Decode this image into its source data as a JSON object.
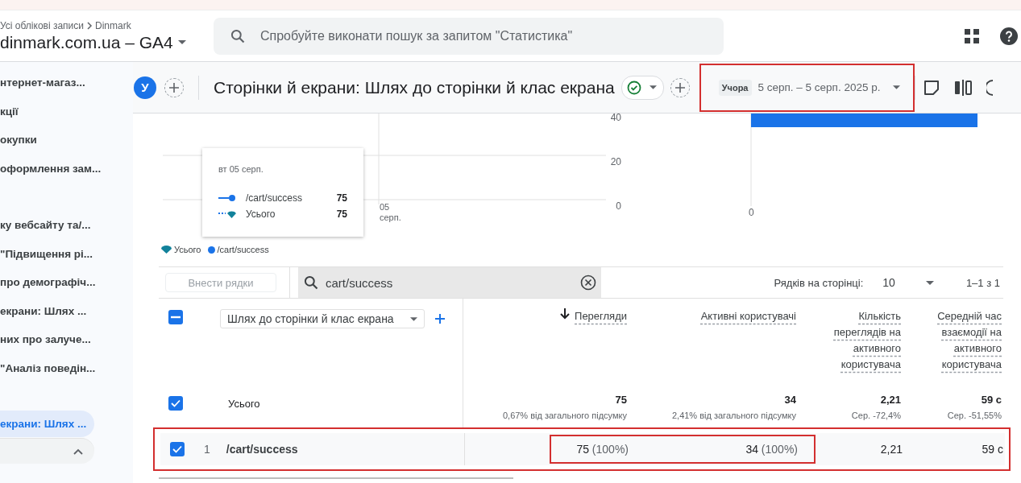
{
  "header": {
    "breadcrumb": [
      "Усі облікові записи",
      "Dinmark"
    ],
    "property": "dinmark.com.ua – GA4",
    "search": {
      "placeholder": "Спробуйте виконати пошук за запитом \"Статистика\""
    }
  },
  "sidebar": {
    "groups": [
      {
        "items": [
          {
            "label": "нтернет-магаз...",
            "selected": false
          },
          {
            "label": "кції",
            "selected": false
          },
          {
            "label": "окупки",
            "selected": false
          },
          {
            "label": "оформлення зам...",
            "selected": false
          }
        ]
      },
      {
        "items": [
          {
            "label": "ку вебсайту та/...",
            "selected": false
          },
          {
            "label": "\"Підвищення рі...",
            "selected": false
          },
          {
            "label": "про демографіч...",
            "selected": false
          },
          {
            "label": "екрани: Шлях ...",
            "selected": false
          },
          {
            "label": "них про залуче...",
            "selected": false
          },
          {
            "label": "\"Аналіз поведін...",
            "selected": false
          }
        ]
      },
      {
        "items": [
          {
            "label": "екрани: Шлях ...",
            "selected": true
          }
        ]
      }
    ],
    "collapse": {
      "expanded": true
    }
  },
  "toolbar": {
    "avatar": "У",
    "title": "Сторінки й екрани: Шлях до сторінки й клас екрана",
    "date_range": {
      "chip": "Учора",
      "range": "5 серп. – 5 серп. 2025 р.",
      "highlighted": true
    }
  },
  "line_chart": {
    "y_ticks": [
      "40",
      "20",
      "0"
    ],
    "x_label": "05 серп.",
    "tooltip": {
      "date": "вт 05 серп.",
      "rows": [
        {
          "kind": "line",
          "name": "/cart/success",
          "value": "75"
        },
        {
          "kind": "total",
          "name": "Усього",
          "value": "75"
        }
      ]
    },
    "legend": [
      {
        "kind": "total",
        "name": "Усього"
      },
      {
        "kind": "line",
        "name": "/cart/success"
      }
    ]
  },
  "bar_chart": {
    "x_tick": "0"
  },
  "table": {
    "add_rows": "Внести рядки",
    "search": {
      "value": "cart/success"
    },
    "rows_per_page_label": "Рядків на сторінці:",
    "rows_per_page": "10",
    "pagination": "1–1 з 1",
    "select_all": {
      "indeterminate": true
    },
    "dimension": "Шлях до сторінки й клас екрана",
    "columns": [
      {
        "label": "Перегляди",
        "sorted": true
      },
      {
        "label": "Активні користувачі",
        "sorted": false
      },
      {
        "label": "Кількість переглядів на активного користувача",
        "sorted": false
      },
      {
        "label": "Середній час взаємодії на активного користувача",
        "sorted": false
      }
    ],
    "totals": {
      "checked": true,
      "label": "Усього",
      "cells": [
        {
          "value": "75",
          "note": "0,67% від загального підсумку"
        },
        {
          "value": "34",
          "note": "2,41% від загального підсумку"
        },
        {
          "value": "2,21",
          "note": "Сер. -72,4%"
        },
        {
          "value": "59 с",
          "note": "Сер. -51,55%"
        }
      ]
    },
    "rows": [
      {
        "checked": true,
        "index": "1",
        "name": "/cart/success",
        "highlighted": true,
        "cells": [
          {
            "value": "75",
            "share": "(100%)",
            "highlighted": true
          },
          {
            "value": "34",
            "share": "(100%)",
            "highlighted": true
          },
          {
            "value": "2,21",
            "highlighted": false
          },
          {
            "value": "59 с",
            "highlighted": false
          }
        ]
      }
    ]
  }
}
